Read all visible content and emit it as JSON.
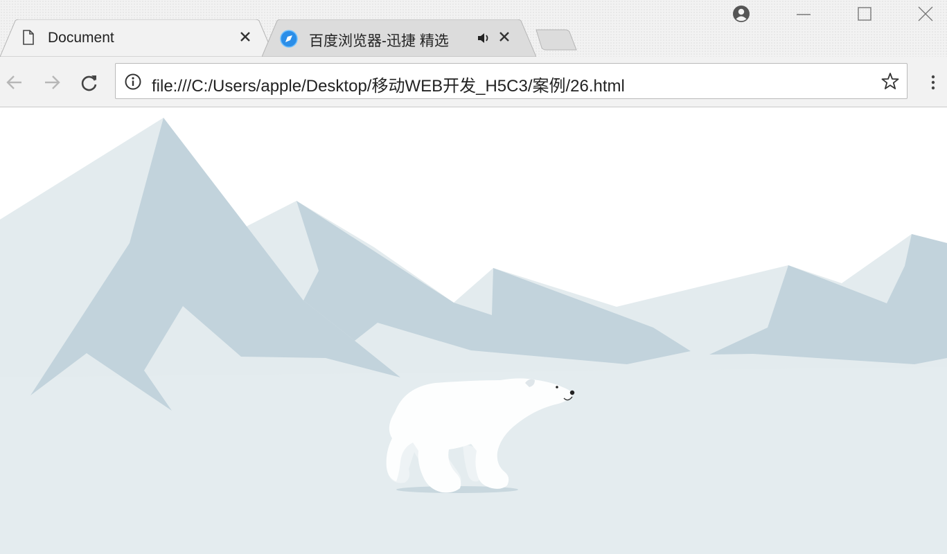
{
  "browser": {
    "tabs": [
      {
        "title": "Document",
        "active": true,
        "icon": "document-icon"
      },
      {
        "title": "百度浏览器-迅捷 精选",
        "active": false,
        "icon": "baidu-browser-icon",
        "audio": true
      }
    ],
    "address": {
      "url": "file:///C:/Users/apple/Desktop/移动WEB开发_H5C3/案例/26.html"
    }
  },
  "scene": {
    "colors": {
      "sky": "#ffffff",
      "ground": "#e4ecef",
      "mountain_light": "#e3ebee",
      "mountain_dark": "#c2d3dc",
      "bear": "#fdfefe",
      "bear_shadow": "#c8d7de"
    }
  }
}
